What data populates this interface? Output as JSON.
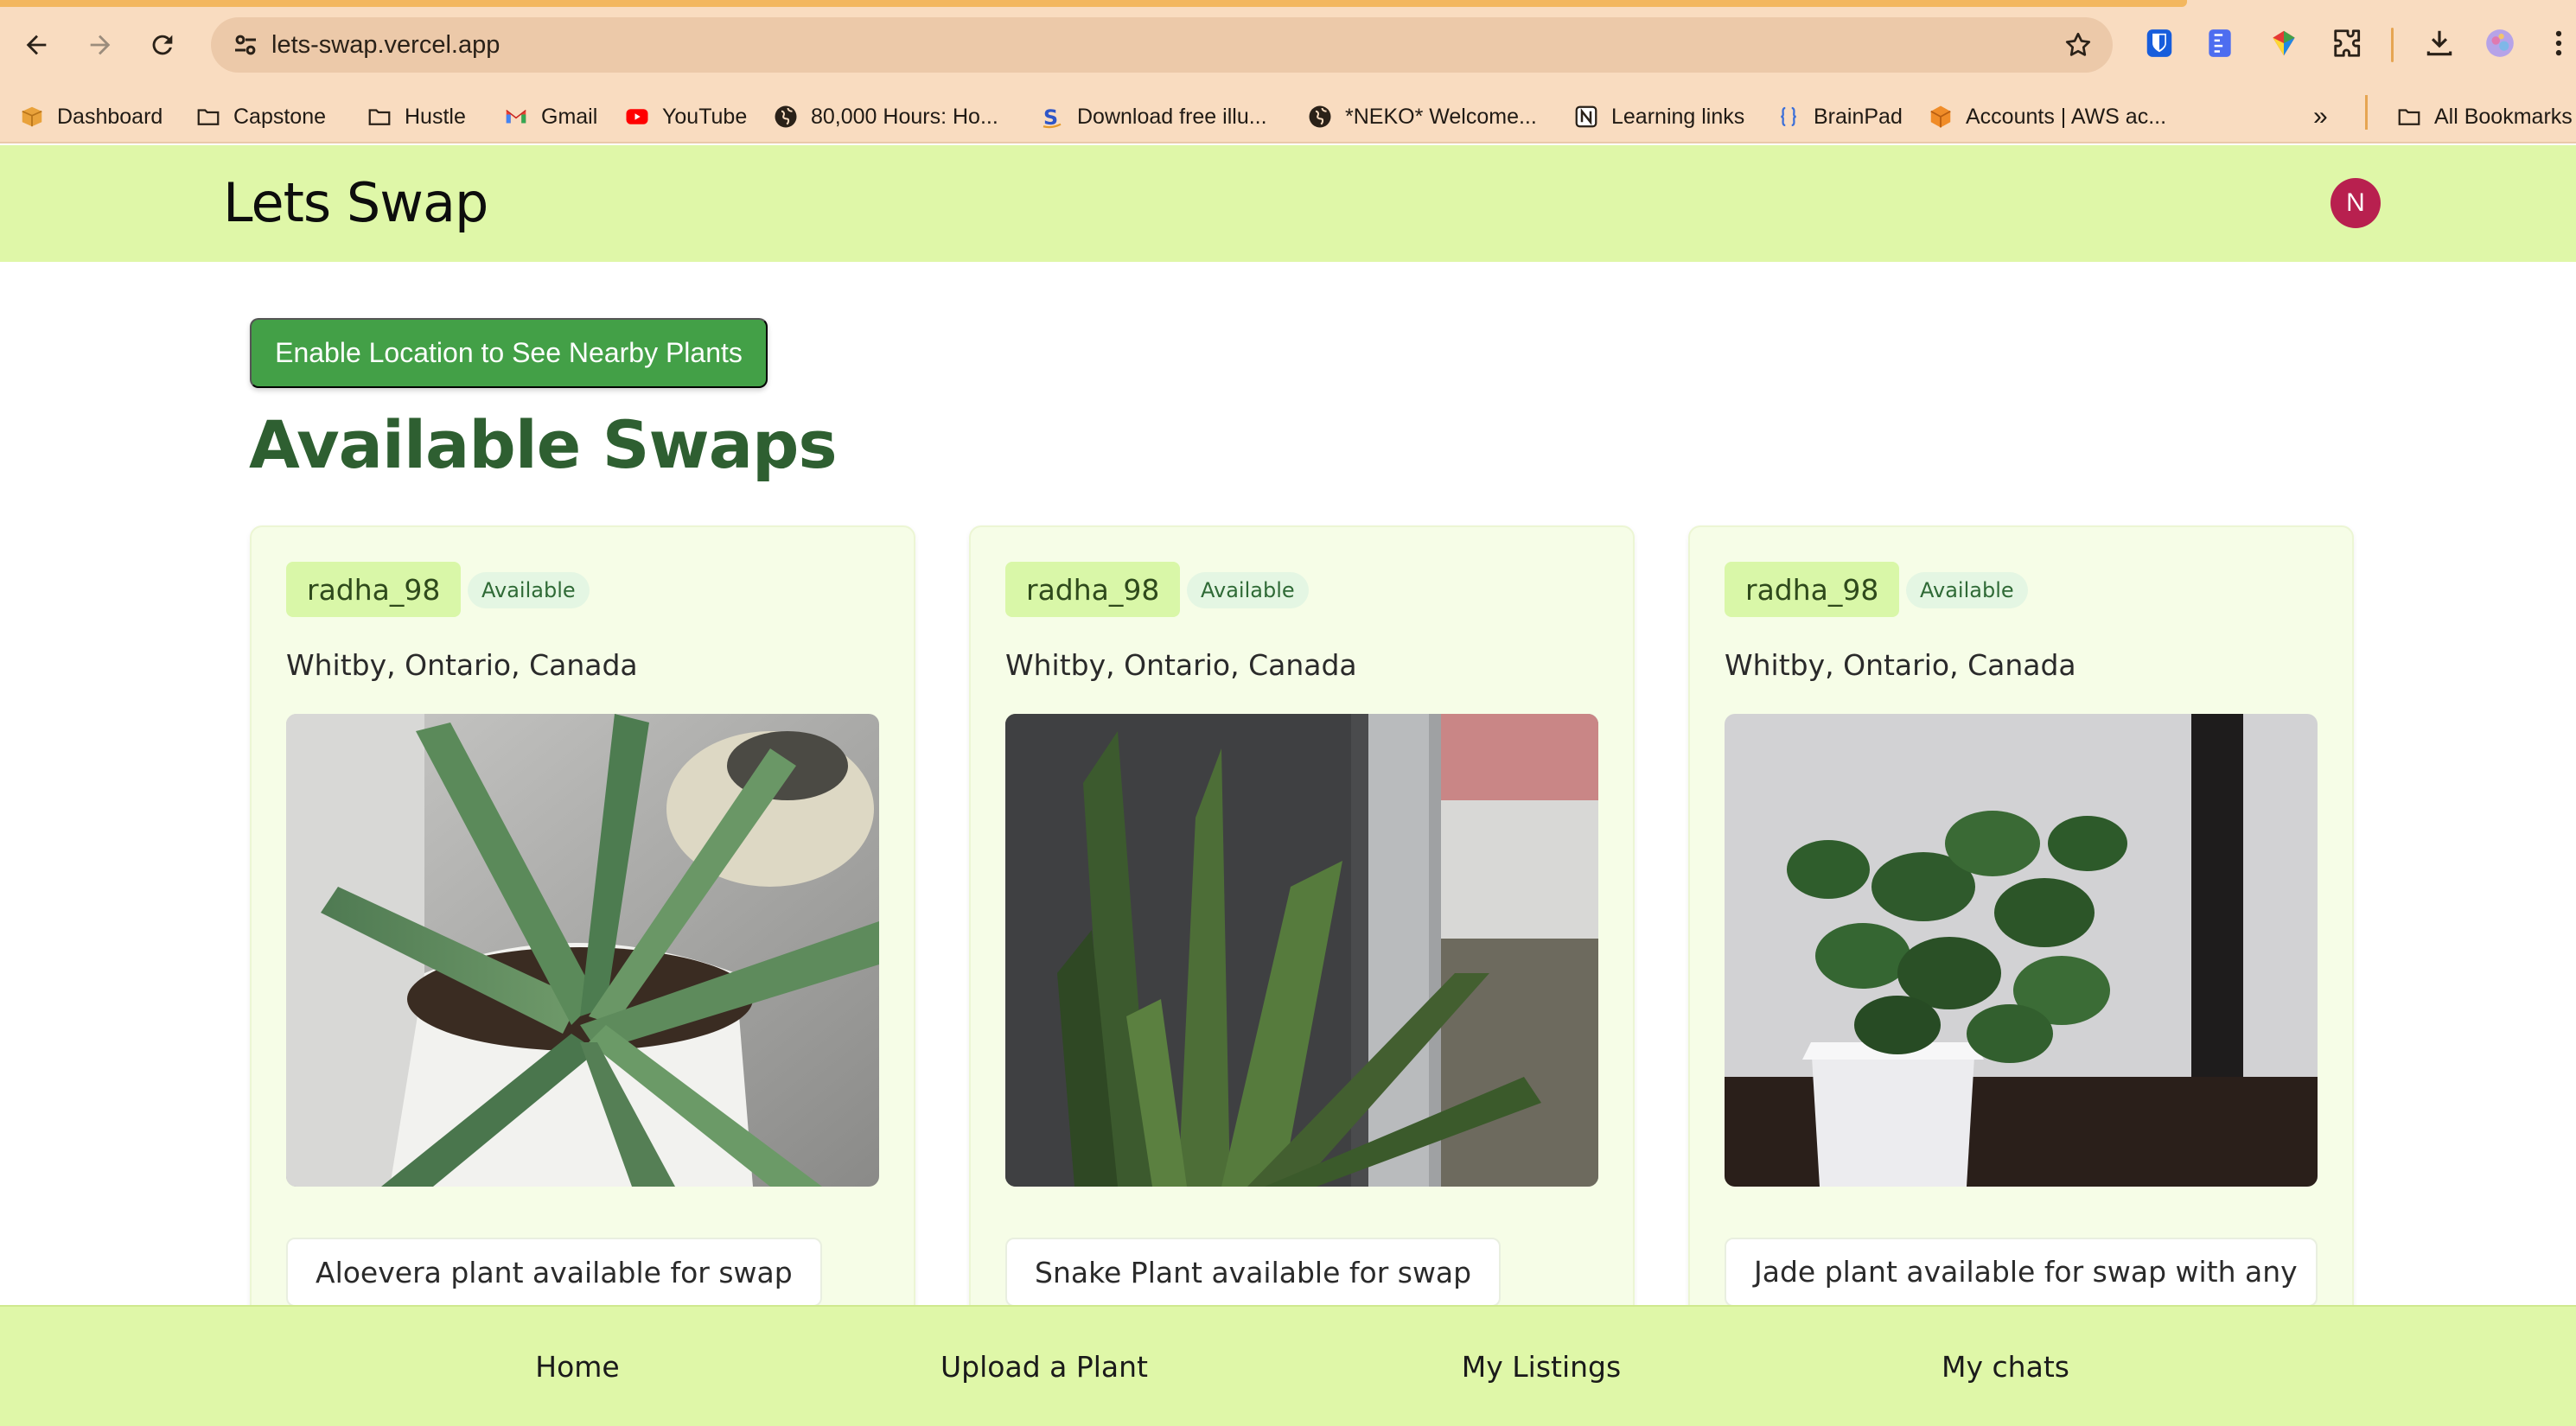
{
  "browser": {
    "url": "lets-swap.vercel.app",
    "bookmarks": [
      {
        "label": "Dashboard",
        "icon": "box-icon"
      },
      {
        "label": "Capstone",
        "icon": "folder-icon"
      },
      {
        "label": "Hustle",
        "icon": "folder-icon"
      },
      {
        "label": "Gmail",
        "icon": "gmail-icon"
      },
      {
        "label": "YouTube",
        "icon": "youtube-icon"
      },
      {
        "label": "80,000 Hours: Ho...",
        "icon": "globe-icon"
      },
      {
        "label": "Download free illu...",
        "icon": "s-logo-icon"
      },
      {
        "label": "*NEKO* Welcome...",
        "icon": "globe-icon"
      },
      {
        "label": "Learning links",
        "icon": "notion-icon"
      },
      {
        "label": "BrainPad",
        "icon": "braces-icon"
      },
      {
        "label": "Accounts | AWS ac...",
        "icon": "aws-cube-icon"
      }
    ],
    "all_bookmarks_label": "All Bookmarks",
    "more_label": "»"
  },
  "app": {
    "logo": "Lets Swap",
    "avatar_initial": "N",
    "location_button": "Enable Location to See Nearby Plants",
    "page_title": "Available Swaps"
  },
  "listings": [
    {
      "user": "radha_98",
      "status": "Available",
      "location": "Whitby, Ontario, Canada",
      "description": "Aloevera plant available for swap",
      "photo": "aloe-vera-photo"
    },
    {
      "user": "radha_98",
      "status": "Available",
      "location": "Whitby, Ontario, Canada",
      "description": "Snake Plant available for swap",
      "photo": "snake-plant-photo"
    },
    {
      "user": "radha_98",
      "status": "Available",
      "location": "Whitby, Ontario, Canada",
      "description": "Jade plant available for swap with any",
      "photo": "jade-plant-photo"
    }
  ],
  "bottom_nav": [
    "Home",
    "Upload a Plant",
    "My Listings",
    "My chats"
  ],
  "colors": {
    "chrome": "#f9dcc0",
    "header": "#dff7a8",
    "primary_button": "#43a047",
    "title": "#2e5f31",
    "avatar": "#b8204f"
  }
}
